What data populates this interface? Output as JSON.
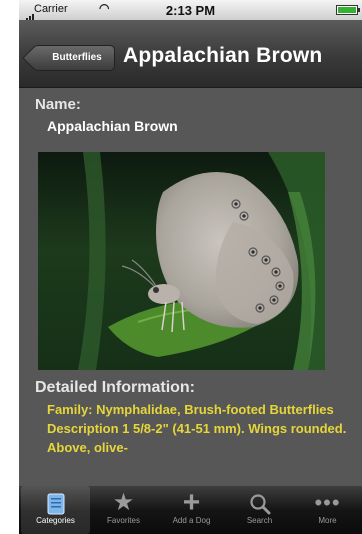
{
  "status_bar": {
    "carrier": "Carrier",
    "time": "2:13 PM"
  },
  "navbar": {
    "back_label": "Butterflies",
    "title": "Appalachian Brown"
  },
  "detail": {
    "name_label": "Name:",
    "name_value": "Appalachian Brown",
    "info_label": "Detailed Information:",
    "info_text": "Family: Nymphalidae, Brush-footed Butterflies Description 1 5/8-2\" (41-51 mm). Wings rounded. Above, olive-"
  },
  "tabbar": {
    "items": [
      {
        "label": "Categories",
        "icon": "book-icon"
      },
      {
        "label": "Favorites",
        "icon": "star-icon"
      },
      {
        "label": "Add a Dog",
        "icon": "plus-icon"
      },
      {
        "label": "Search",
        "icon": "search-icon"
      },
      {
        "label": "More",
        "icon": "more-icon"
      }
    ]
  },
  "colors": {
    "detail_text": "#e6d63a",
    "background": "#575757",
    "battery": "#34b233"
  }
}
